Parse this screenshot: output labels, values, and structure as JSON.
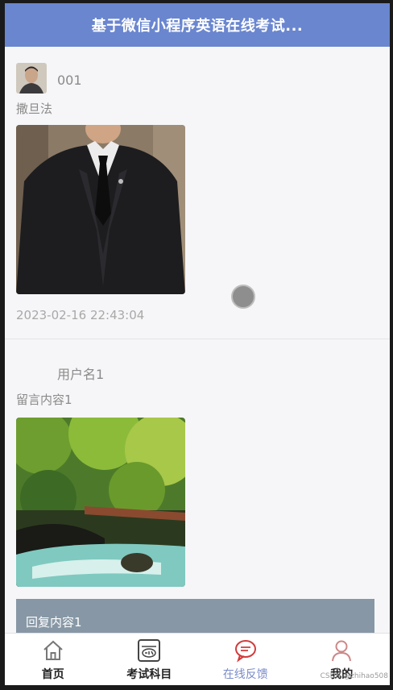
{
  "navbar": {
    "title": "基于微信小程序英语在线考试..."
  },
  "posts": [
    {
      "username": "001",
      "message": "撒旦法",
      "time": "2023-02-16 22:43:04"
    },
    {
      "username": "用户名1",
      "message": "留言内容1",
      "reply": "回复内容1"
    }
  ],
  "tabbar": {
    "items": [
      {
        "label": "首页",
        "icon": "home-icon"
      },
      {
        "label": "考试科目",
        "icon": "exam-icon"
      },
      {
        "label": "在线反馈",
        "icon": "feedback-icon",
        "active": true
      },
      {
        "label": "我的",
        "icon": "user-icon"
      }
    ],
    "active_color": "#7a8cc8"
  },
  "watermark": "CSDN @zhihao508",
  "colors": {
    "navbar": "#6a86cf",
    "reply_bg": "#8797a5"
  }
}
